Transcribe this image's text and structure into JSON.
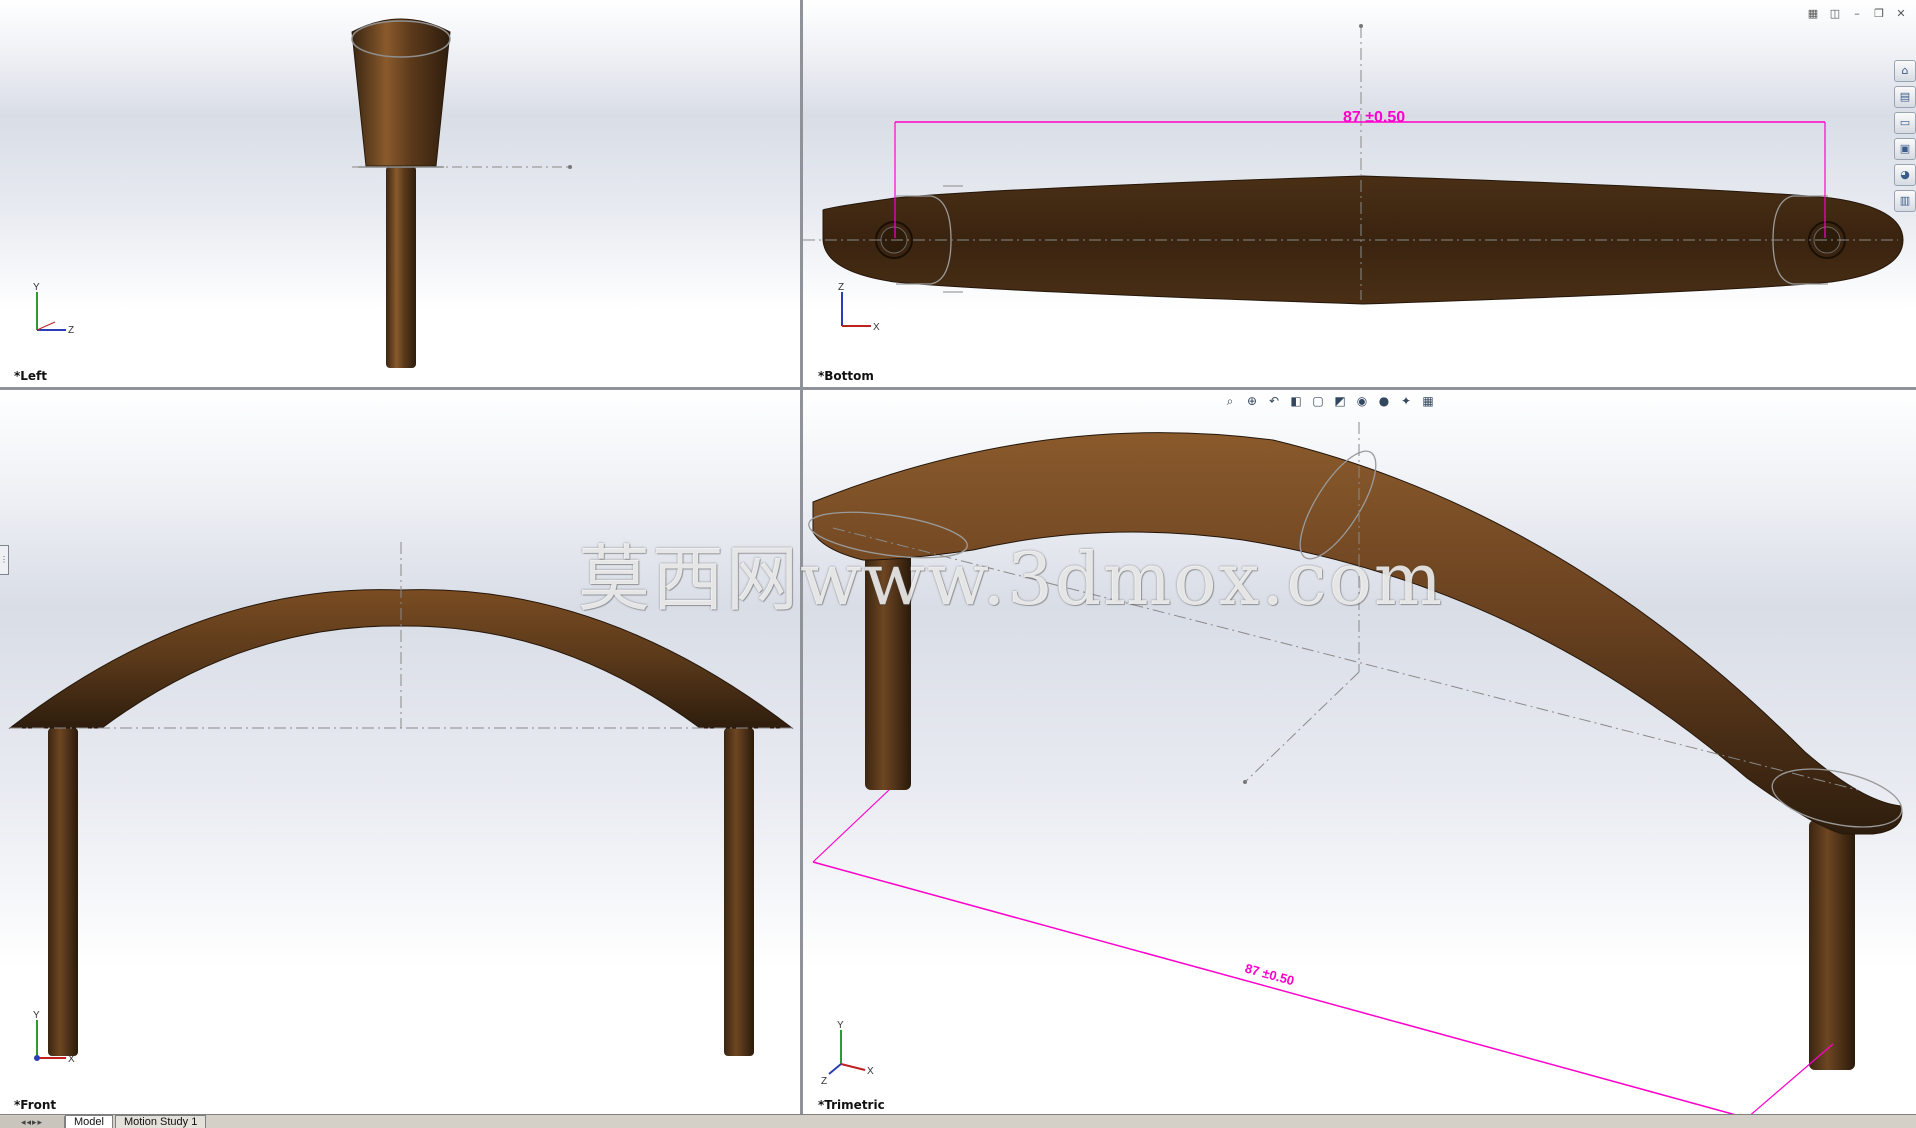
{
  "views": {
    "left": {
      "label": "*Left",
      "triad": {
        "up": "Y",
        "right": "Z"
      }
    },
    "bottom": {
      "label": "*Bottom",
      "triad": {
        "up": "Z",
        "right": "X"
      },
      "dimension": "87 ±0.50"
    },
    "front": {
      "label": "*Front",
      "triad": {
        "up": "Y",
        "right": "X"
      }
    },
    "trimetric": {
      "label": "*Trimetric",
      "triad": {
        "up": "Y",
        "right": "X",
        "out": "Z"
      },
      "dimension": "87 ±0.50"
    }
  },
  "watermark": "莫西网www.3dmox.com",
  "window_controls": [
    "tile-icon",
    "split-icon",
    "minimize-icon",
    "restore-icon",
    "close-icon"
  ],
  "task_pane_buttons": [
    "home-icon",
    "design-library-icon",
    "file-explorer-icon",
    "view-palette-icon",
    "appearances-icon",
    "custom-properties-icon"
  ],
  "heads_up_toolbar": [
    "zoom-to-fit-icon",
    "zoom-to-area-icon",
    "previous-view-icon",
    "section-view-icon",
    "view-orientation-icon",
    "display-style-icon",
    "hide-show-icon",
    "edit-appearance-icon",
    "apply-scene-icon",
    "view-settings-icon"
  ],
  "bottom_tabs": [
    "Model",
    "Motion Study 1"
  ],
  "colors": {
    "wood_dark": "#3f2914",
    "wood_mid": "#6e4521",
    "wood_light": "#a87643",
    "dimension": "#ff00cc",
    "sketch": "#7a7a7a"
  }
}
